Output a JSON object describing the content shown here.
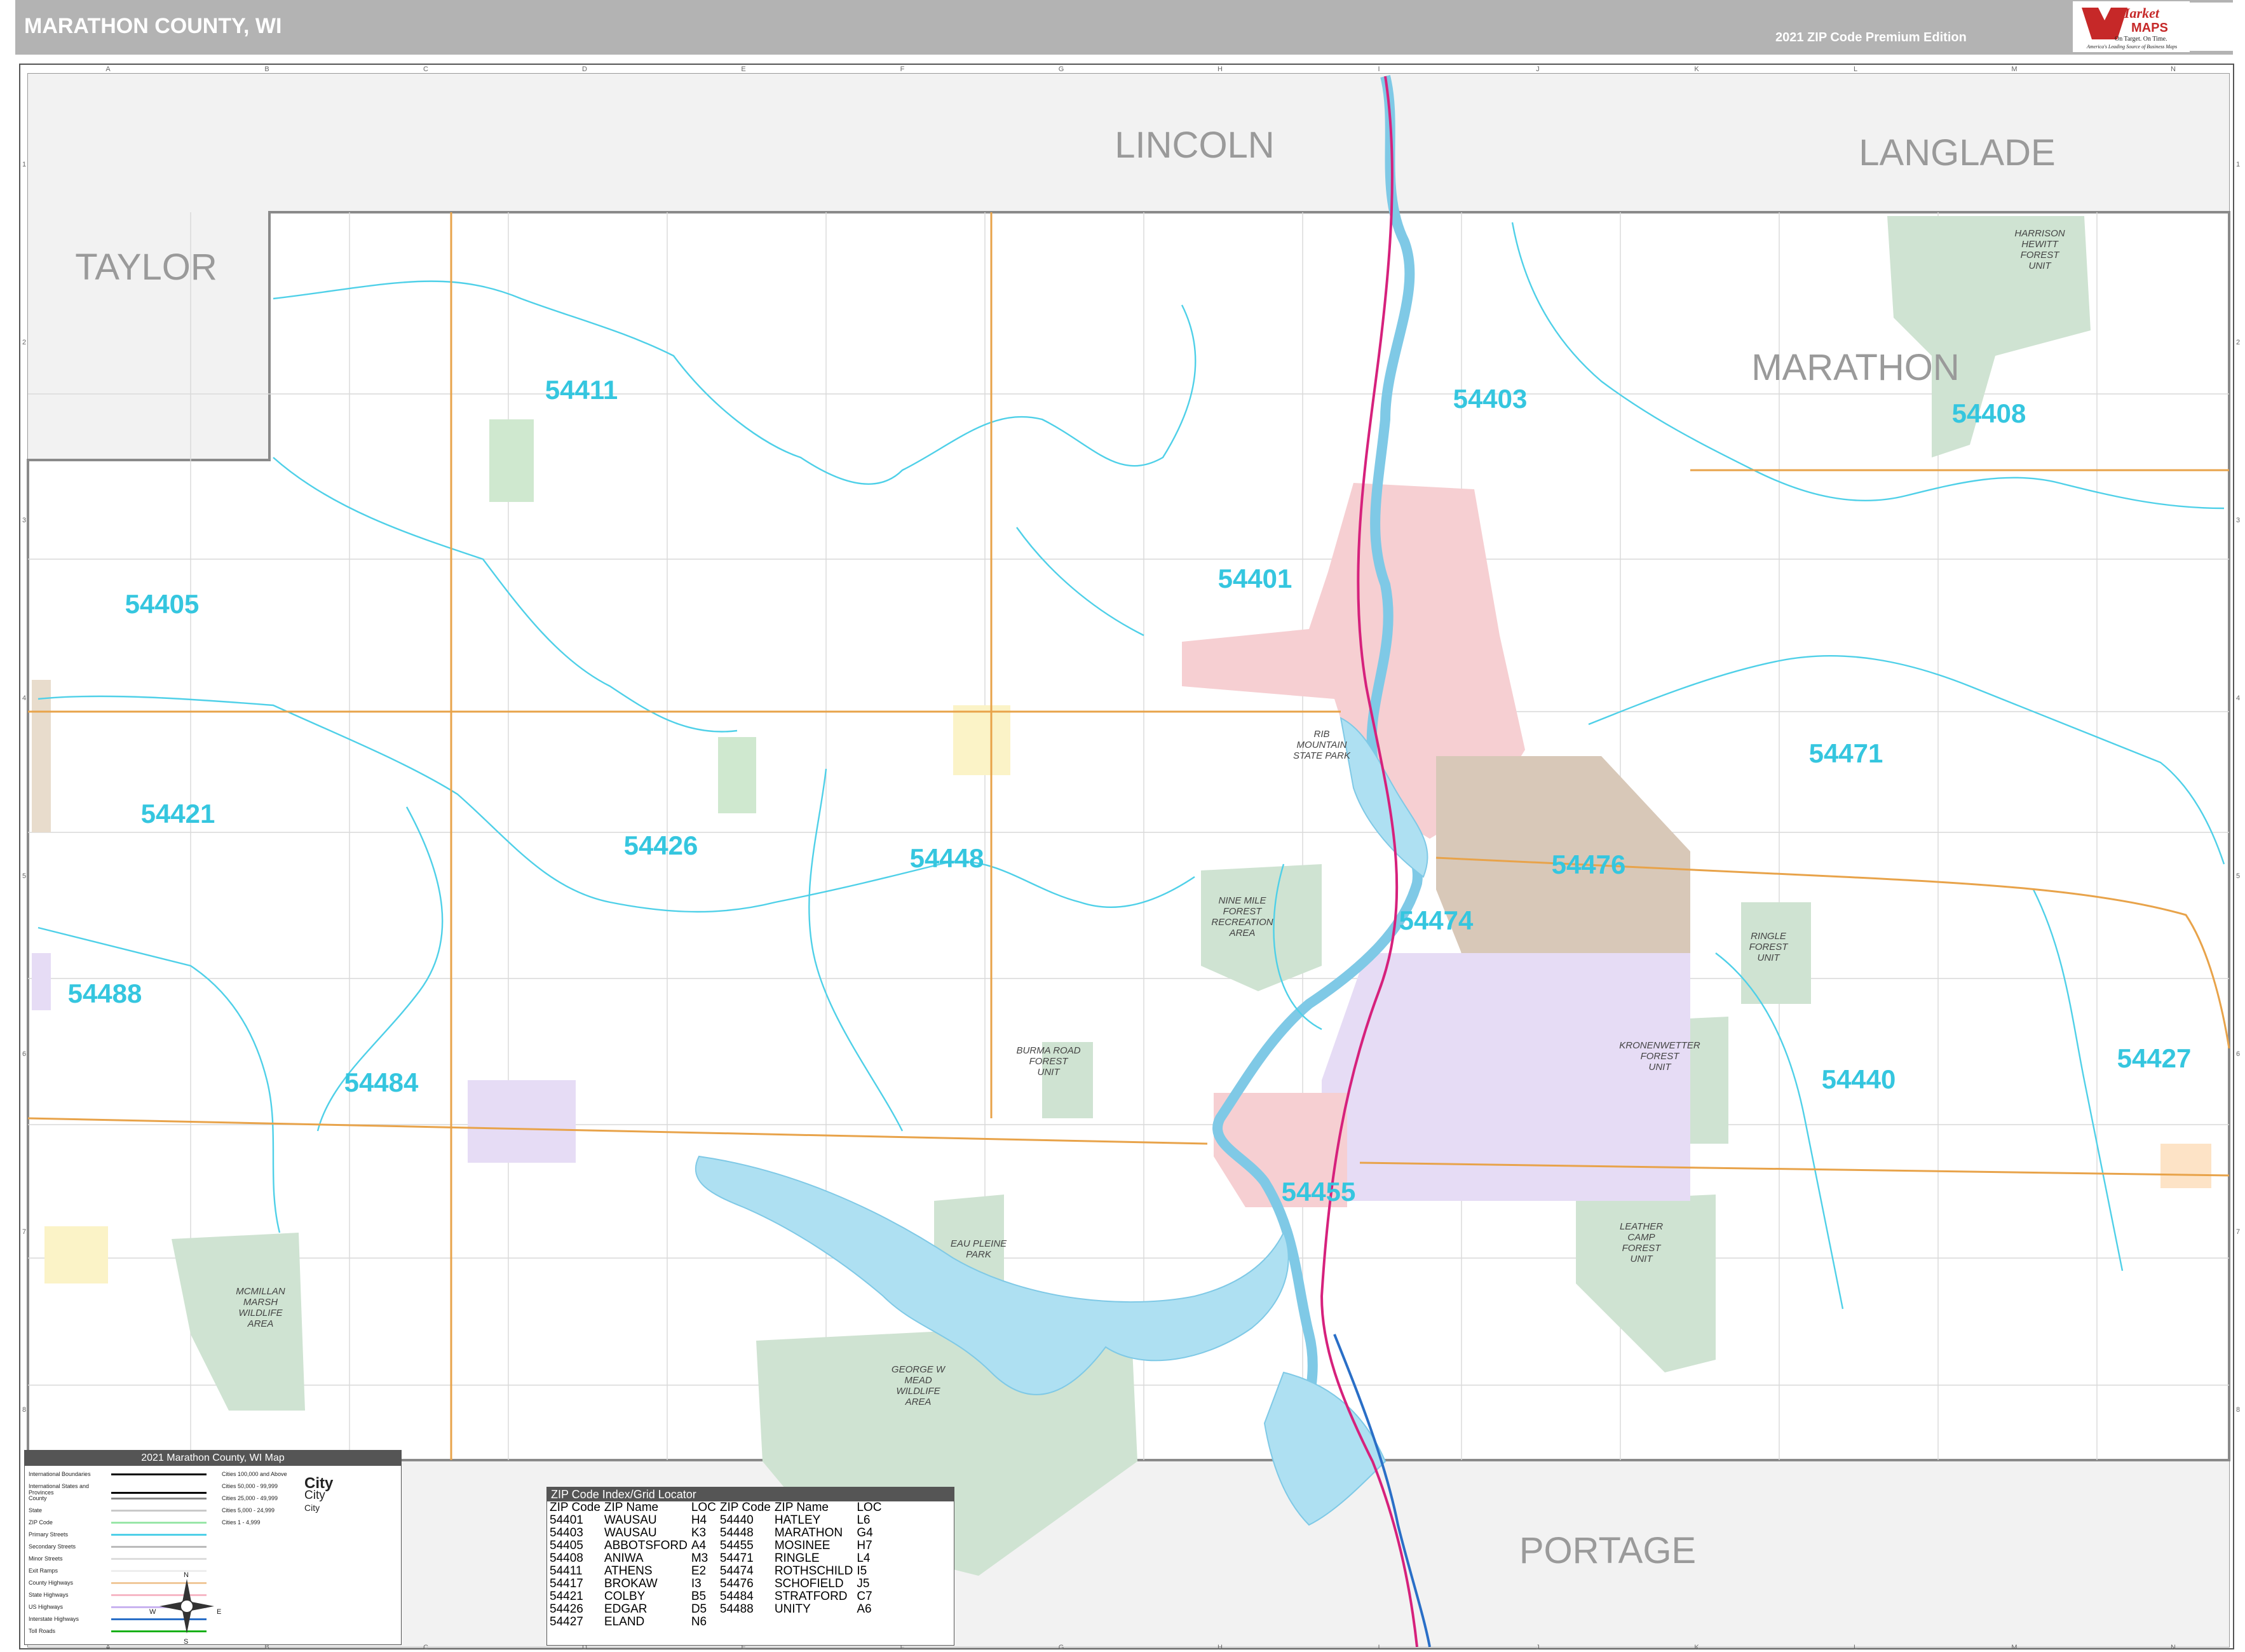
{
  "header": {
    "title": "MARATHON COUNTY, WI",
    "edition": "2021 ZIP Code Premium Edition"
  },
  "logo": {
    "brand_1": "Market",
    "brand_2": "MAPS",
    "tagline": "On Target. On Time.",
    "tagline2": "America's Leading Source of Business Maps"
  },
  "counties": [
    "LINCOLN",
    "LANGLADE",
    "TAYLOR",
    "MARATHON",
    "PORTAGE"
  ],
  "zip_labels": [
    "54411",
    "54403",
    "54408",
    "54405",
    "54401",
    "54471",
    "54421",
    "54426",
    "54448",
    "54476",
    "54488",
    "54474",
    "54484",
    "54440",
    "54427",
    "54455"
  ],
  "parks": [
    "HARRISON HEWITT FOREST UNIT",
    "RIB MOUNTAIN STATE PARK",
    "NINE MILE FOREST RECREATION AREA",
    "RINGLE FOREST UNIT",
    "BURMA ROAD FOREST UNIT",
    "KRONENWETTER FOREST UNIT",
    "LEATHER CAMP FOREST UNIT",
    "EAU PLEINE PARK",
    "MCMILLAN MARSH WILDLIFE AREA",
    "GEORGE W MEAD WILDLIFE AREA"
  ],
  "grid": {
    "columns": [
      "A",
      "B",
      "C",
      "D",
      "E",
      "F",
      "G",
      "H",
      "I",
      "J",
      "K",
      "L",
      "M",
      "N"
    ],
    "rows": [
      "1",
      "2",
      "3",
      "4",
      "5",
      "6",
      "7",
      "8"
    ]
  },
  "legend": {
    "title": "2021 Marathon County, WI Map",
    "left_items": [
      "International Boundaries",
      "International States and Provinces",
      "County",
      "State",
      "ZIP Code",
      "Primary Streets",
      "Secondary Streets",
      "Minor Streets",
      "Exit Ramps",
      "County Highways",
      "State Highways",
      "US Highways",
      "Interstate Highways",
      "Toll Roads"
    ],
    "right_items": [
      "Cities 100,000 and Above",
      "Cities 50,000 - 99,999",
      "Cities 25,000 - 49,999",
      "Cities 5,000 - 24,999",
      "Cities 1 - 4,999"
    ],
    "city_styles": [
      "City",
      "City",
      "City"
    ],
    "compass": [
      "N",
      "S",
      "E",
      "W"
    ]
  },
  "locator": {
    "title": "ZIP Code Index/Grid Locator",
    "headers": [
      "ZIP Code",
      "ZIP Name",
      "LOC",
      "ZIP Code",
      "ZIP Name",
      "LOC"
    ],
    "rows": [
      [
        "54401",
        "WAUSAU",
        "H4",
        "54440",
        "HATLEY",
        "L6"
      ],
      [
        "54403",
        "WAUSAU",
        "K3",
        "54448",
        "MARATHON",
        "G4"
      ],
      [
        "54405",
        "ABBOTSFORD",
        "A4",
        "54455",
        "MOSINEE",
        "H7"
      ],
      [
        "54408",
        "ANIWA",
        "M3",
        "54471",
        "RINGLE",
        "L4"
      ],
      [
        "54411",
        "ATHENS",
        "E2",
        "54474",
        "ROTHSCHILD",
        "I5"
      ],
      [
        "54417",
        "BROKAW",
        "I3",
        "54476",
        "SCHOFIELD",
        "J5"
      ],
      [
        "54421",
        "COLBY",
        "B5",
        "54484",
        "STRATFORD",
        "C7"
      ],
      [
        "54426",
        "EDGAR",
        "D5",
        "54488",
        "UNITY",
        "A6"
      ],
      [
        "54427",
        "ELAND",
        "N6",
        "",
        "",
        ""
      ]
    ]
  },
  "colors": {
    "zip_label": "#35c6df",
    "zip_boundary": "#4fd0e8",
    "forest": "#cfe3d2",
    "water": "#aee0f2",
    "city_pink": "#f6cfd2",
    "schofield": "#d8c8b8",
    "lavender": "#e6dcf5",
    "highway_orange": "#e8a34a",
    "interstate_pink": "#d6217c",
    "us_blue": "#2a6fc7"
  }
}
